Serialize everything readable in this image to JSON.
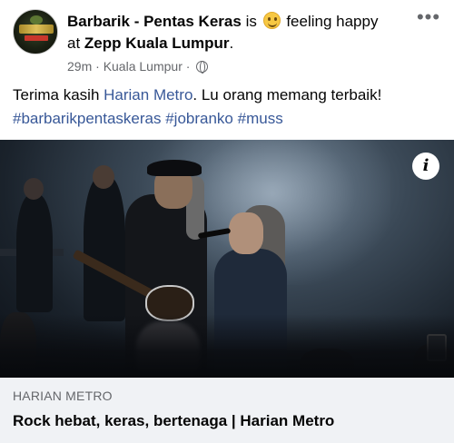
{
  "post": {
    "author": "Barbarik - Pentas Keras",
    "is_text": "is",
    "feeling": "feeling happy",
    "at_text": "at",
    "location_tag": "Zepp Kuala Lumpur",
    "after_location": ".",
    "time": "29m",
    "meta_sep": "·",
    "place": "Kuala Lumpur",
    "meta_sep2": "·",
    "privacy_icon": "globe-icon",
    "more_label": "•••",
    "text_before_link": "Terima kasih ",
    "mention": "Harian Metro",
    "text_after_link": ". Lu orang memang terbaik!",
    "hashtags": [
      "#barbarikpentaskeras",
      "#jobranko",
      "#muss"
    ]
  },
  "media": {
    "info_label": "i"
  },
  "link_card": {
    "domain": "HARIAN METRO",
    "title": "Rock hebat, keras, bertenaga | Harian Metro"
  },
  "colors": {
    "link": "#385898",
    "secondary_text": "#65676b",
    "card_bg": "#f0f2f5"
  }
}
